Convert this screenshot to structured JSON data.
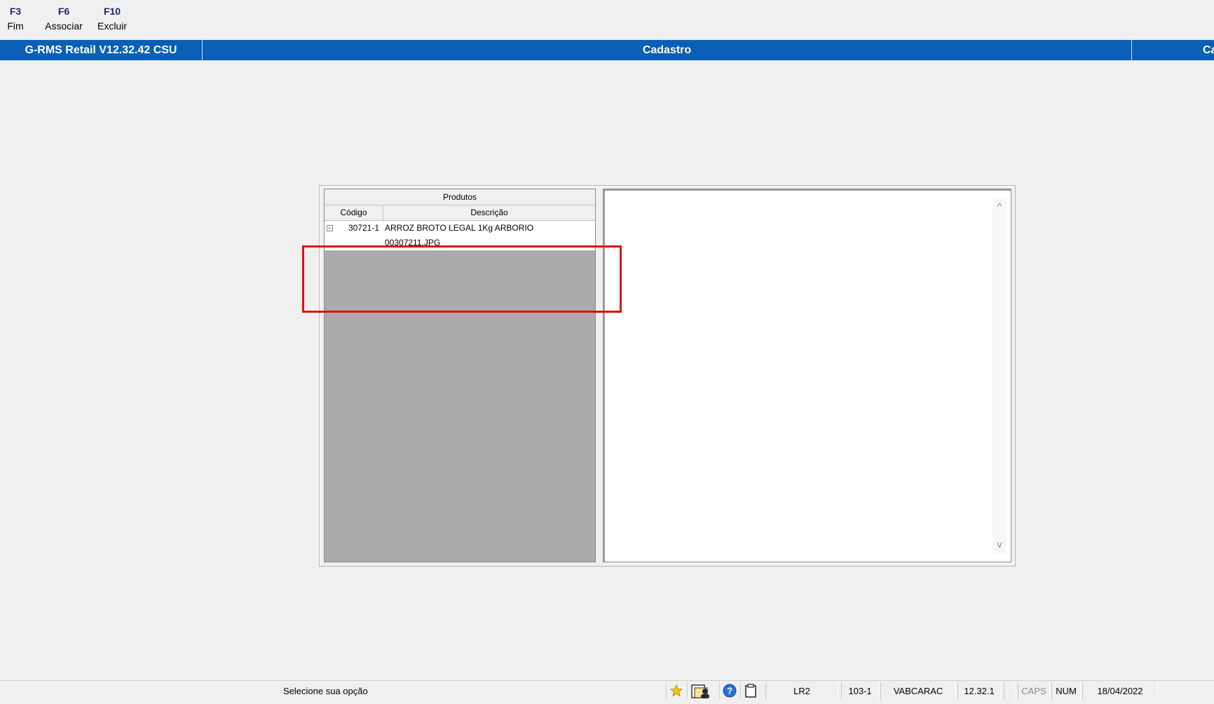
{
  "toolbar": {
    "items": [
      {
        "key": "F3",
        "label": "Fim"
      },
      {
        "key": "F6",
        "label": "Associar"
      },
      {
        "key": "F10",
        "label": "Excluir"
      }
    ]
  },
  "titlebar": {
    "app": "G-RMS Retail V12.32.42 CSU",
    "center": "Cadastro",
    "right": "Ca"
  },
  "grid": {
    "header": "Produtos",
    "columns": [
      "Código",
      "Descrição"
    ],
    "rows": [
      {
        "toggle": "−",
        "code": "30721-1",
        "description": "ARROZ BROTO LEGAL 1Kg ARBORIO"
      },
      {
        "toggle": "",
        "code": "",
        "description": "00307211.JPG"
      }
    ]
  },
  "viewer": {
    "scroll_up": "^",
    "scroll_down": "v"
  },
  "status": {
    "message": "Selecione sua opção",
    "icons": [
      "star-icon",
      "users-icon",
      "help-icon",
      "clipboard-icon"
    ],
    "cells": [
      "LR2",
      "103-1",
      "VABCARAC",
      "12.32.1",
      "",
      "CAPS",
      "NUM",
      "18/04/2022"
    ]
  },
  "colors": {
    "titlebar": "#0a5fb6",
    "highlight": "#e01010",
    "grid_empty": "#ababab"
  }
}
